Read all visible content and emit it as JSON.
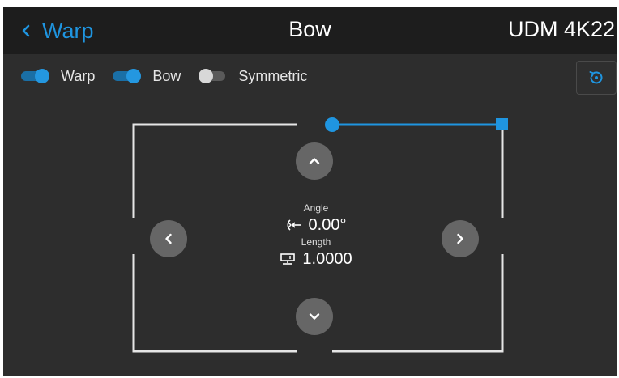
{
  "header": {
    "back_label": "Warp",
    "title": "Bow",
    "model": "UDM 4K22",
    "back_icon": "chevron-left-icon"
  },
  "toggles": [
    {
      "label": "Warp",
      "state": "on"
    },
    {
      "label": "Bow",
      "state": "on"
    },
    {
      "label": "Symmetric",
      "state": "off"
    }
  ],
  "reset_icon": "reset-icon",
  "controls": {
    "up_icon": "chevron-up-icon",
    "down_icon": "chevron-down-icon",
    "left_icon": "chevron-left-icon",
    "right_icon": "chevron-right-icon"
  },
  "info": {
    "angle_label": "Angle",
    "angle_value": "0.00°",
    "angle_icon": "angle-icon",
    "length_label": "Length",
    "length_value": "1.0000",
    "length_icon": "length-icon"
  },
  "colors": {
    "accent": "#1f95e0",
    "header_bg": "#1d1d1d",
    "panel_bg": "#2d2d2d",
    "outline": "#e6e6e6",
    "button": "#666666"
  }
}
